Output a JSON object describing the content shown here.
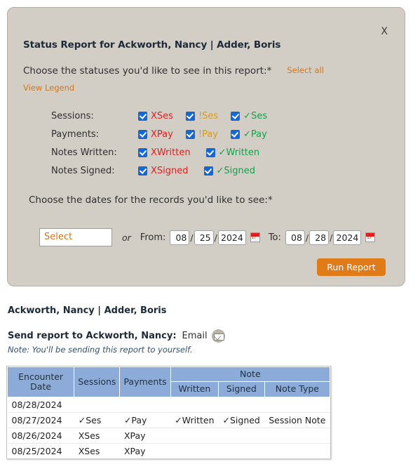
{
  "modal": {
    "close_label": "X",
    "title": "Status Report for Ackworth, Nancy | Adder, Boris",
    "statuses_prompt": "Choose the statuses you'd like to see in this report:*",
    "select_all_label": "Select all",
    "view_legend_label": "View Legend",
    "dates_prompt": "Choose the dates for the records you'd like to see:*",
    "status_rows": [
      {
        "label": "Sessions:",
        "options": [
          {
            "text": "XSes",
            "color_class": "c-red",
            "checked": true
          },
          {
            "text": "!Ses",
            "color_class": "c-amber",
            "checked": true
          },
          {
            "text": "✓Ses",
            "color_class": "c-green",
            "checked": true
          }
        ]
      },
      {
        "label": "Payments:",
        "options": [
          {
            "text": "XPay",
            "color_class": "c-red",
            "checked": true
          },
          {
            "text": "!Pay",
            "color_class": "c-amber",
            "checked": true
          },
          {
            "text": "✓Pay",
            "color_class": "c-green",
            "checked": true
          }
        ]
      },
      {
        "label": "Notes Written:",
        "options": [
          {
            "text": "XWritten",
            "color_class": "c-red",
            "checked": true
          },
          {
            "text": "✓Written",
            "color_class": "c-green",
            "checked": true
          }
        ]
      },
      {
        "label": "Notes Signed:",
        "options": [
          {
            "text": "XSigned",
            "color_class": "c-red",
            "checked": true
          },
          {
            "text": "✓Signed",
            "color_class": "c-green",
            "checked": true
          }
        ]
      }
    ],
    "date_controls": {
      "select_placeholder": "Select",
      "or_label": "or",
      "from_label": "From:",
      "from_month": "08",
      "from_day": "25",
      "from_year": "2024",
      "to_label": "To:",
      "to_month": "08",
      "to_day": "28",
      "to_year": "2024",
      "separator": "/",
      "calendar_icon": "calendar-icon"
    },
    "run_report_label": "Run Report"
  },
  "results": {
    "client_title": "Ackworth, Nancy | Adder, Boris",
    "send_label": "Send report to Ackworth, Nancy:",
    "email_label": "Email",
    "email_icon": "envelope-icon",
    "note": "Note: You'll be sending this report to yourself.",
    "table": {
      "headers": {
        "encounter_date": "Encounter Date",
        "sessions": "Sessions",
        "payments": "Payments",
        "note_group": "Note",
        "written": "Written",
        "signed": "Signed",
        "note_type": "Note Type"
      },
      "rows": [
        {
          "date": "08/28/2024",
          "sessions": "",
          "sessions_class": "",
          "payments": "",
          "payments_class": "",
          "written": "",
          "written_class": "",
          "signed": "",
          "signed_class": "",
          "note_type": ""
        },
        {
          "date": "08/27/2024",
          "sessions": "✓Ses",
          "sessions_class": "v-green",
          "payments": "✓Pay",
          "payments_class": "v-green",
          "written": "✓Written",
          "written_class": "v-green",
          "signed": "✓Signed",
          "signed_class": "v-green",
          "note_type": "Session Note"
        },
        {
          "date": "08/26/2024",
          "sessions": "XSes",
          "sessions_class": "v-red",
          "payments": "XPay",
          "payments_class": "v-red",
          "written": "",
          "written_class": "",
          "signed": "",
          "signed_class": "",
          "note_type": ""
        },
        {
          "date": "08/25/2024",
          "sessions": "XSes",
          "sessions_class": "v-red",
          "payments": "XPay",
          "payments_class": "v-red",
          "written": "",
          "written_class": "",
          "signed": "",
          "signed_class": "",
          "note_type": ""
        }
      ]
    }
  },
  "colors": {
    "modal_bg": "#d2cec6",
    "accent_orange": "#d2761c",
    "button_orange": "#e07b18",
    "checkbox_blue": "#1567d3",
    "table_header_blue": "#8cabd9",
    "status_red": "#e02020",
    "status_amber": "#d89b1a",
    "status_green": "#15a04a"
  }
}
